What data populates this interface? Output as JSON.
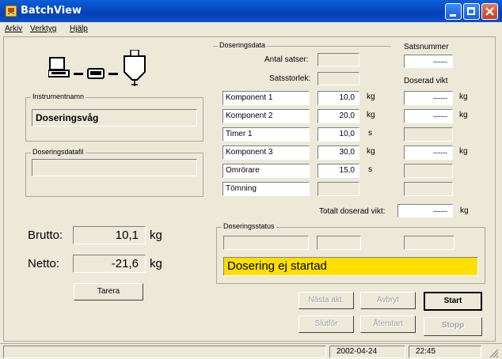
{
  "window": {
    "title": "BatchView"
  },
  "menu": [
    "Arkiv",
    "Verktyg",
    "Hjälp"
  ],
  "instrument": {
    "group_label": "Instrumentnamn",
    "name": "Doseringsvåg"
  },
  "datafile": {
    "group_label": "Doseringsdatafil",
    "value": ""
  },
  "weights": {
    "brutto_label": "Brutto:",
    "brutto_value": "10,1",
    "brutto_unit": "kg",
    "netto_label": "Netto:",
    "netto_value": "-21,6",
    "netto_unit": "kg",
    "tare_button": "Tarera"
  },
  "dosing": {
    "group_label": "Doseringsdata",
    "antal_label": "Antal satser:",
    "storlek_label": "Satsstorlek:",
    "rows": [
      {
        "name": "Komponent 1",
        "value": "10,0",
        "unit": "kg"
      },
      {
        "name": "Komponent 2",
        "value": "20,0",
        "unit": "kg"
      },
      {
        "name": "Timer 1",
        "value": "10,0",
        "unit": "s"
      },
      {
        "name": "Komponent 3",
        "value": "30,0",
        "unit": "kg"
      },
      {
        "name": "Omrörare",
        "value": "15,0",
        "unit": "s"
      },
      {
        "name": "Tömning",
        "value": "",
        "unit": ""
      }
    ],
    "satsnummer_label": "Satsnummer",
    "satsnummer_value": "------",
    "doserad_label": "Doserad vikt",
    "doserad_values": [
      "------",
      "------",
      "",
      "------",
      "",
      ""
    ],
    "doserad_units": [
      "kg",
      "kg",
      "",
      "kg",
      "",
      ""
    ],
    "total_label": "Totalt doserad vikt:",
    "total_value": "------",
    "total_unit": "kg"
  },
  "status": {
    "group_label": "Doseringsstatus",
    "message": "Dosering ej startad",
    "highlight": "#ffde00"
  },
  "buttons": {
    "next": "Nästa akt.",
    "abort": "Avbryt",
    "start": "Start",
    "finish": "Slutför",
    "restart": "Återstart",
    "stop": "Stopp"
  },
  "statusbar": {
    "date": "2002-04-24",
    "time": "22:45"
  }
}
